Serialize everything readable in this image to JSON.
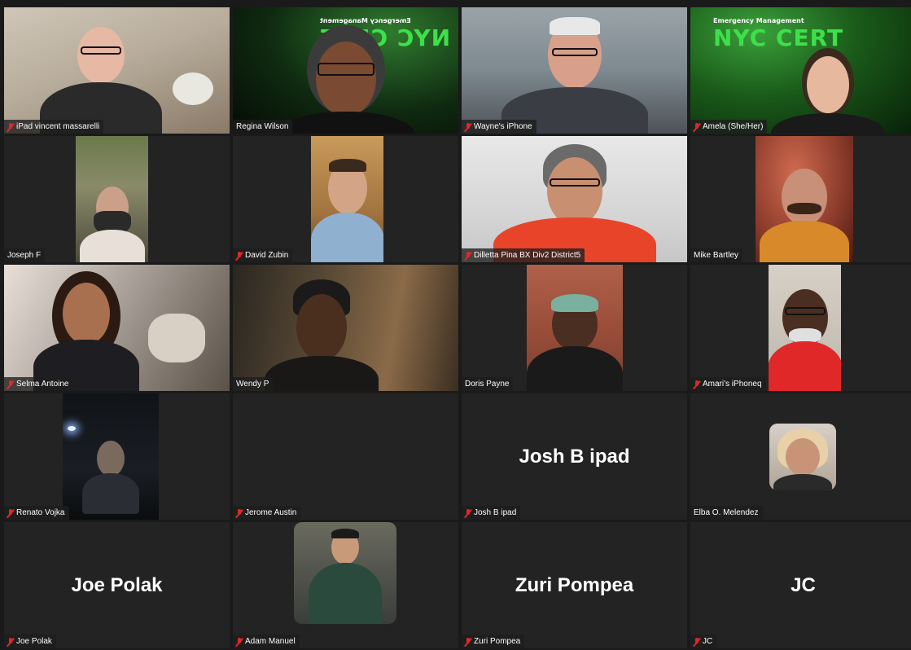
{
  "meeting": {
    "participants": [
      {
        "name": "iPad vincent massarelli",
        "muted": true
      },
      {
        "name": "Regina Wilson",
        "muted": false,
        "active_speaker": true,
        "background_text": "NYC CERT",
        "background_subtext": "Emergency Management"
      },
      {
        "name": "Wayne's iPhone",
        "muted": true
      },
      {
        "name": "Amela (She/Her)",
        "muted": true,
        "background_text": "NYC CERT",
        "background_subtext": "Emergency Management"
      },
      {
        "name": "Joseph F",
        "muted": false
      },
      {
        "name": "David Zubin",
        "muted": true
      },
      {
        "name": "Dilletta Pina BX Div2 District5",
        "muted": true
      },
      {
        "name": "Mike  Bartley",
        "muted": false
      },
      {
        "name": "Selma Antoine",
        "muted": true
      },
      {
        "name": "Wendy P",
        "muted": false
      },
      {
        "name": "Doris Payne",
        "muted": false
      },
      {
        "name": "Amari's iPhoneq",
        "muted": true
      },
      {
        "name": "Renato Vojka",
        "muted": true
      },
      {
        "name": "Jerome Austin",
        "muted": true
      },
      {
        "name": "Josh B ipad",
        "muted": true,
        "display_text": "Josh B ipad"
      },
      {
        "name": "Elba O. Melendez",
        "muted": false
      },
      {
        "name": "Joe Polak",
        "muted": true,
        "display_text": "Joe Polak"
      },
      {
        "name": "Adam Manuel",
        "muted": true
      },
      {
        "name": "Zuri Pompea",
        "muted": true,
        "display_text": "Zuri Pompea"
      },
      {
        "name": "JC",
        "muted": true,
        "display_text": "JC"
      }
    ]
  },
  "colors": {
    "background": "#1a1a1a",
    "tile": "#232323",
    "active_border": "#23d160",
    "muted_mic": "#e02828",
    "cert_green": "#3ee04a"
  },
  "icons": {
    "muted": "mic-muted-icon"
  }
}
